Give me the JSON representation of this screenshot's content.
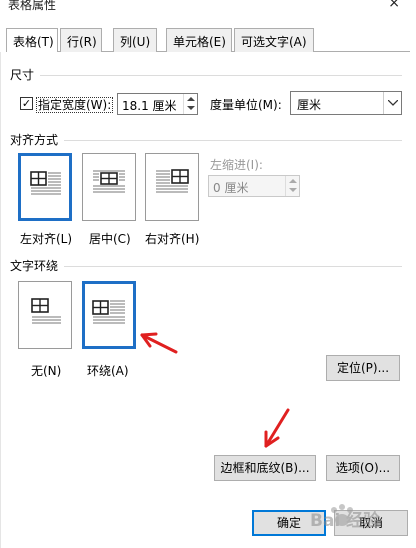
{
  "window": {
    "title": "表格属性",
    "close_glyph": "×"
  },
  "tabs": [
    {
      "label": "表格(T)"
    },
    {
      "label": "行(R)"
    },
    {
      "label": "列(U)"
    },
    {
      "label": "单元格(E)"
    },
    {
      "label": "可选文字(A)"
    }
  ],
  "size": {
    "section_label": "尺寸",
    "preferred_width_label": "指定宽度(W):",
    "preferred_width_checked": true,
    "width_value": "18.1 厘米",
    "unit_label": "度量单位(M):",
    "unit_value": "厘米"
  },
  "alignment": {
    "section_label": "对齐方式",
    "options": [
      {
        "label": "左对齐(L)",
        "selected": true
      },
      {
        "label": "居中(C)",
        "selected": false
      },
      {
        "label": "右对齐(H)",
        "selected": false
      }
    ],
    "indent_label": "左缩进(I):",
    "indent_value": "0 厘米"
  },
  "wrapping": {
    "section_label": "文字环绕",
    "options": [
      {
        "label": "无(N)",
        "selected": false
      },
      {
        "label": "环绕(A)",
        "selected": true
      }
    ],
    "position_button": "定位(P)..."
  },
  "bottom": {
    "borders_button": "边框和底纹(B)...",
    "options_button": "选项(O)...",
    "ok_button": "确定",
    "cancel_button": "取消"
  },
  "watermark_text": "Bai 经验",
  "colors": {
    "accent": "#1e6fc6",
    "arrow": "#e02020"
  }
}
